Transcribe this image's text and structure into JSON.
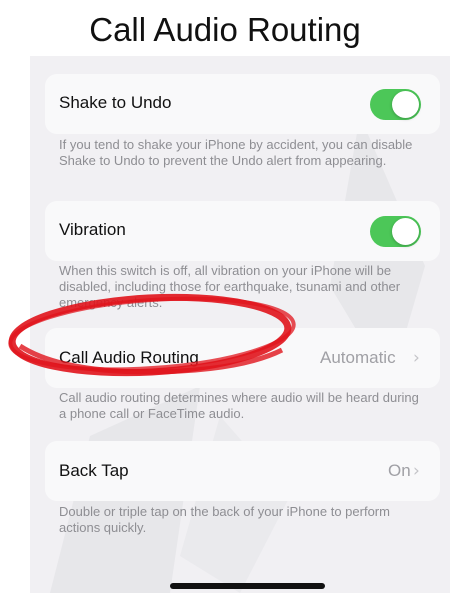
{
  "header": {
    "title": "Call Audio Routing"
  },
  "settings": {
    "shake_to_undo": {
      "label": "Shake to Undo",
      "enabled": true,
      "description": "If you tend to shake your iPhone by accident, you can disable Shake to Undo to prevent the Undo alert from appearing."
    },
    "vibration": {
      "label": "Vibration",
      "enabled": true,
      "description": "When this switch is off, all vibration on your iPhone will be disabled, including those for earthquake, tsunami and other emergency alerts."
    },
    "call_audio_routing": {
      "label": "Call Audio Routing",
      "value": "Automatic",
      "description": "Call audio routing determines where audio will be heard during a phone call or FaceTime audio."
    },
    "back_tap": {
      "label": "Back Tap",
      "value": "On",
      "description": "Double or triple tap on the back of your iPhone to perform actions quickly."
    }
  },
  "icons": {
    "chevron": "chevron-right-icon"
  },
  "colors": {
    "toggle_on": "#4cc758",
    "highlight": "#e0141c",
    "background": "#f1f0f3",
    "cell": "#f9f9fa"
  }
}
